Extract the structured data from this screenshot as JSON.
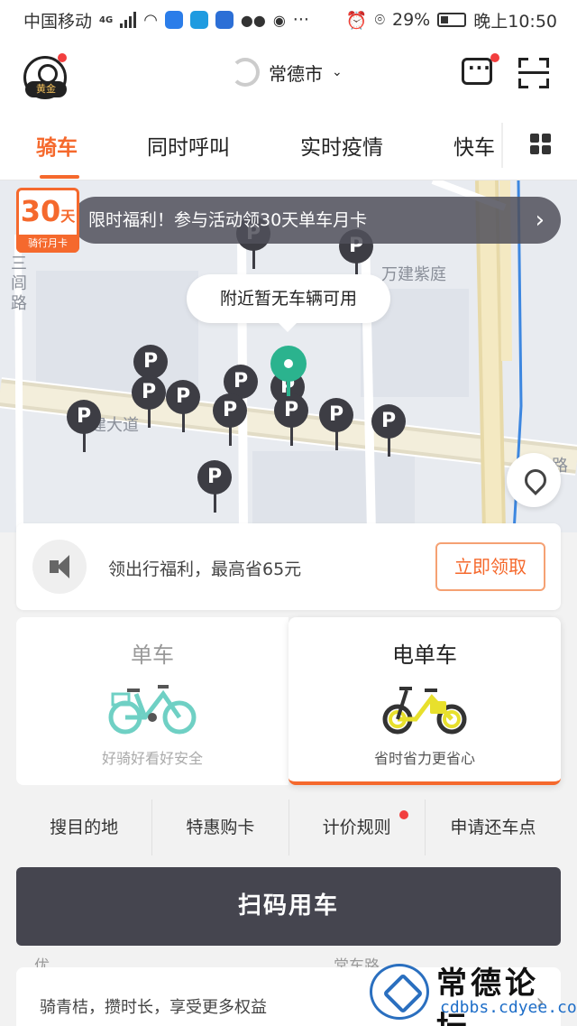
{
  "status_bar": {
    "carrier": "中国移动",
    "network": "4G",
    "battery": "29%",
    "time": "晚上10:50",
    "more": "···"
  },
  "header": {
    "badge": "黄金",
    "city": "常德市"
  },
  "tabs": {
    "items": [
      {
        "label": "骑车",
        "active": true
      },
      {
        "label": "同时呼叫"
      },
      {
        "label": "实时疫情"
      },
      {
        "label": "快车"
      }
    ]
  },
  "map": {
    "promo_card_number": "30",
    "promo_card_unit": "天",
    "promo_card_label": "骑行月卡",
    "banner": "限时福利！参与活动领30天单车月卡",
    "tooltip": "附近暂无车辆可用",
    "labels": {
      "wanjian": "万建紫庭",
      "road_left_1": "三",
      "road_left_2": "闾",
      "road_left_3": "路",
      "avenue": "建大道",
      "road_right": "路"
    },
    "parking_marker": "P"
  },
  "welfare": {
    "text": "领出行福利，最高省65元",
    "button": "立即领取"
  },
  "bikes": {
    "single": {
      "title": "单车",
      "subtitle": "好骑好看好安全"
    },
    "ebike": {
      "title": "电单车",
      "subtitle": "省时省力更省心"
    }
  },
  "quick_links": [
    "搜目的地",
    "特惠购卡",
    "计价规则",
    "申请还车点"
  ],
  "main_button": "扫码用车",
  "bottom": {
    "peek_left": "优",
    "peek_road": "常车路",
    "text": "骑青桔，攒时长，享受更多权益",
    "arrow": "›"
  },
  "watermark": {
    "title": "常德论坛",
    "url": "cdbbs.cdyee.com"
  },
  "colors": {
    "accent": "#f5692d",
    "pin": "#3d3d44",
    "location": "#2bb38e",
    "alert_dot": "#f23e3e",
    "button_dark": "#45454f"
  }
}
